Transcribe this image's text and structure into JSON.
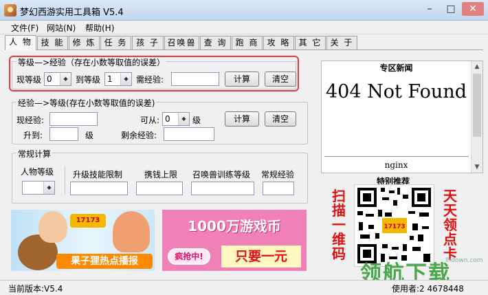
{
  "window": {
    "title": "梦幻西游实用工具箱 V5.4",
    "minimize_glyph": "–",
    "maximize_glyph": "□",
    "close_glyph": "✕"
  },
  "menu": [
    "文件(F)",
    "网站(N)",
    "帮助(H)"
  ],
  "tabs": [
    "人 物",
    "技 能",
    "修 炼",
    "任 务",
    "孩 子",
    "召唤兽",
    "查 询",
    "跑 商",
    "攻 略",
    "其 它",
    "关 于"
  ],
  "active_tab": 0,
  "group1": {
    "title": "等级—>经验（存在小数等取值的误差）",
    "cur_level_label": "现等级",
    "cur_level_value": "0",
    "to_level_label": "到等级",
    "to_level_value": "1",
    "need_exp_label": "需经验:",
    "need_exp_value": "",
    "calc_button": "计算",
    "clear_button": "清空"
  },
  "group2": {
    "title": "经验—>等级(存在小数等取值的误差)",
    "cur_exp_label": "现经验:",
    "cur_exp_value": "",
    "can_from_label": "可从:",
    "can_from_value": "0",
    "level_unit": "级",
    "rise_to_label": "升到:",
    "rise_to_value": "",
    "level_unit2": "级",
    "remain_exp_label": "剩余经验:",
    "remain_exp_value": "",
    "calc_button": "计算",
    "clear_button": "清空"
  },
  "group3": {
    "title": "常规计算",
    "char_level_label": "人物等级",
    "skill_limit_label": "升级技能限制",
    "money_limit_label": "携钱上限",
    "pet_train_label": "召唤兽训练等级",
    "regular_exp_label": "常规经验"
  },
  "news": {
    "title": "专区新闻",
    "heading": "404 Not Found",
    "server": "nginx"
  },
  "promo": {
    "title": "特别推荐",
    "left_text": [
      "扫",
      "描",
      "一",
      "维",
      "码"
    ],
    "right_text": [
      "天",
      "天",
      "领",
      "点",
      "卡"
    ]
  },
  "banner1": {
    "logo": "17173",
    "caption": "果子狸热点播报"
  },
  "banner2": {
    "headline": "1000万游戏币",
    "grab": "疯抢中!",
    "price": "只要一元"
  },
  "status": {
    "version": "当前版本:V5.4",
    "usage": "使用者:2 4678448"
  },
  "watermark": {
    "text": "领航下载",
    "url": "lhdown.com"
  },
  "colors": {
    "highlight": "#e23b3b",
    "promo_red": "#e01010"
  }
}
